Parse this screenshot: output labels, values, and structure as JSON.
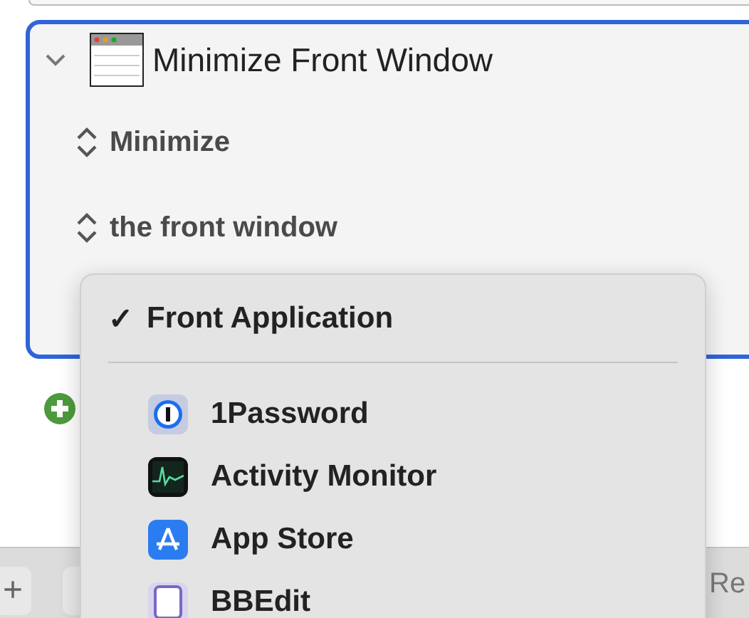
{
  "action": {
    "title": "Minimize Front Window",
    "expanded": true,
    "fields": [
      {
        "value": "Minimize"
      },
      {
        "value": "the front window"
      }
    ]
  },
  "menu": {
    "items": [
      {
        "kind": "option",
        "label": "Front Application",
        "selected": true,
        "check": "✓"
      },
      {
        "kind": "app",
        "label": "1Password",
        "selected": false
      },
      {
        "kind": "app",
        "label": "Activity Monitor",
        "selected": false
      },
      {
        "kind": "app",
        "label": "App Store",
        "selected": false
      },
      {
        "kind": "app",
        "label": "BBEdit",
        "selected": false
      }
    ]
  },
  "toolbar": {
    "add": "+",
    "record": "Re"
  }
}
